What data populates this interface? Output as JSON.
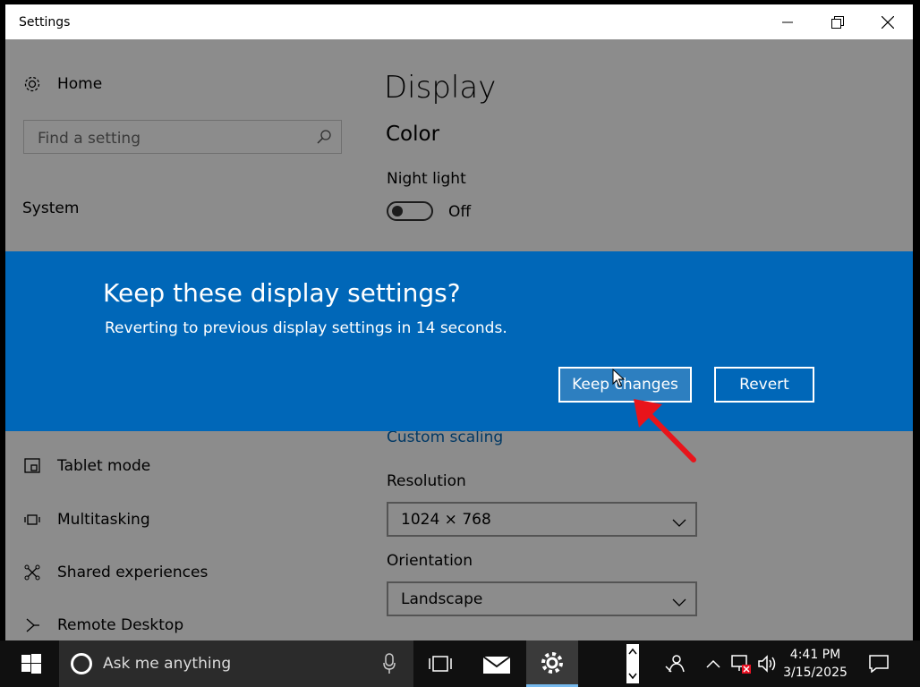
{
  "window": {
    "title": "Settings"
  },
  "sidebar": {
    "home_label": "Home",
    "search_placeholder": "Find a setting",
    "section_header": "System",
    "items": [
      {
        "label": "Tablet mode",
        "icon": "tablet-mode-icon"
      },
      {
        "label": "Multitasking",
        "icon": "multitasking-icon"
      },
      {
        "label": "Shared experiences",
        "icon": "shared-experiences-icon"
      },
      {
        "label": "Remote Desktop",
        "icon": "remote-desktop-icon"
      }
    ]
  },
  "main": {
    "page_title": "Display",
    "color_header": "Color",
    "night_light_label": "Night light",
    "night_light_state": "Off",
    "custom_scaling_link": "Custom scaling",
    "resolution_label": "Resolution",
    "resolution_value": "1024 × 768",
    "orientation_label": "Orientation",
    "orientation_value": "Landscape"
  },
  "dialog": {
    "title": "Keep these display settings?",
    "message": "Reverting to previous display settings in 14 seconds.",
    "keep_label": "Keep changes",
    "revert_label": "Revert",
    "accent_color": "#0067b8"
  },
  "taskbar": {
    "search_placeholder": "Ask me anything",
    "clock_time": "4:41 PM",
    "clock_date": "3/15/2025"
  },
  "annotation": {
    "arrow_color": "#e8141b"
  }
}
